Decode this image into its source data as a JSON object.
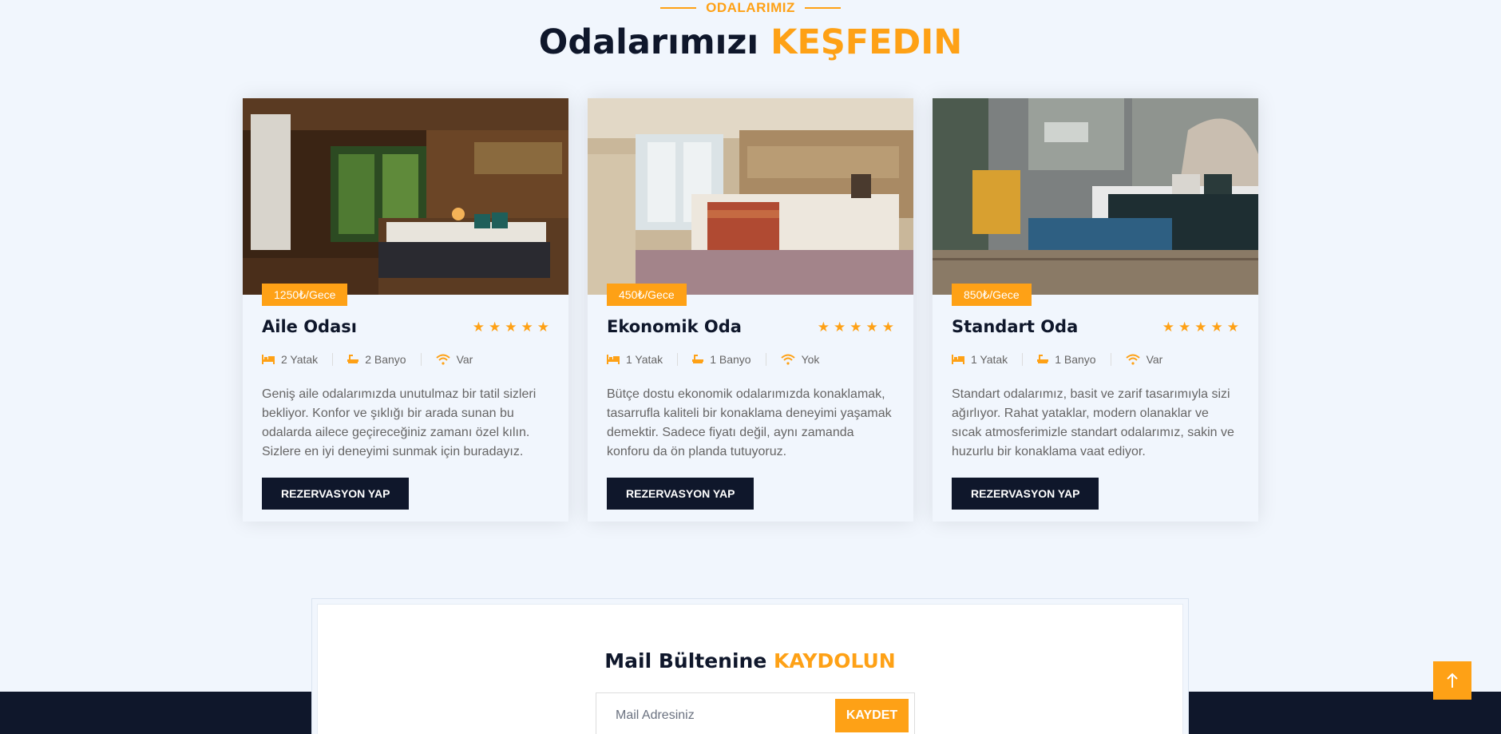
{
  "header": {
    "subtitle": "ODALARIMIZ",
    "title_main": "Odalarımızı",
    "title_accent": "KEŞFEDIN"
  },
  "rooms": [
    {
      "price": "1250₺/Gece",
      "name": "Aile Odası",
      "rating": 5,
      "beds": "2 Yatak",
      "baths": "2 Banyo",
      "wifi": "Var",
      "description": "Geniş aile odalarımızda unutulmaz bir tatil sizleri bekliyor. Konfor ve şıklığı bir arada sunan bu odalarda ailece geçireceğiniz zamanı özel kılın. Sizlere en iyi deneyimi sunmak için buradayız.",
      "button": "REZERVASYON YAP"
    },
    {
      "price": "450₺/Gece",
      "name": "Ekonomik Oda",
      "rating": 5,
      "beds": "1 Yatak",
      "baths": "1 Banyo",
      "wifi": "Yok",
      "description": "Bütçe dostu ekonomik odalarımızda konaklamak, tasarrufla kaliteli bir konaklama deneyimi yaşamak demektir. Sadece fiyatı değil, aynı zamanda konforu da ön planda tutuyoruz.",
      "button": "REZERVASYON YAP"
    },
    {
      "price": "850₺/Gece",
      "name": "Standart Oda",
      "rating": 5,
      "beds": "1 Yatak",
      "baths": "1 Banyo",
      "wifi": "Var",
      "description": "Standart odalarımız, basit ve zarif tasarımıyla sizi ağırlıyor. Rahat yataklar, modern olanaklar ve sıcak atmosferimizle standart odalarımız, sakin ve huzurlu bir konaklama vaat ediyor.",
      "button": "REZERVASYON YAP"
    }
  ],
  "newsletter": {
    "title_main": "Mail Bültenine",
    "title_accent": "KAYDOLUN",
    "placeholder": "Mail Adresiniz",
    "button": "KAYDET"
  },
  "colors": {
    "accent": "#fea116",
    "dark": "#0f172b",
    "background": "#f1f6fd"
  },
  "icons": {
    "back_to_top": "arrow-up-icon"
  }
}
